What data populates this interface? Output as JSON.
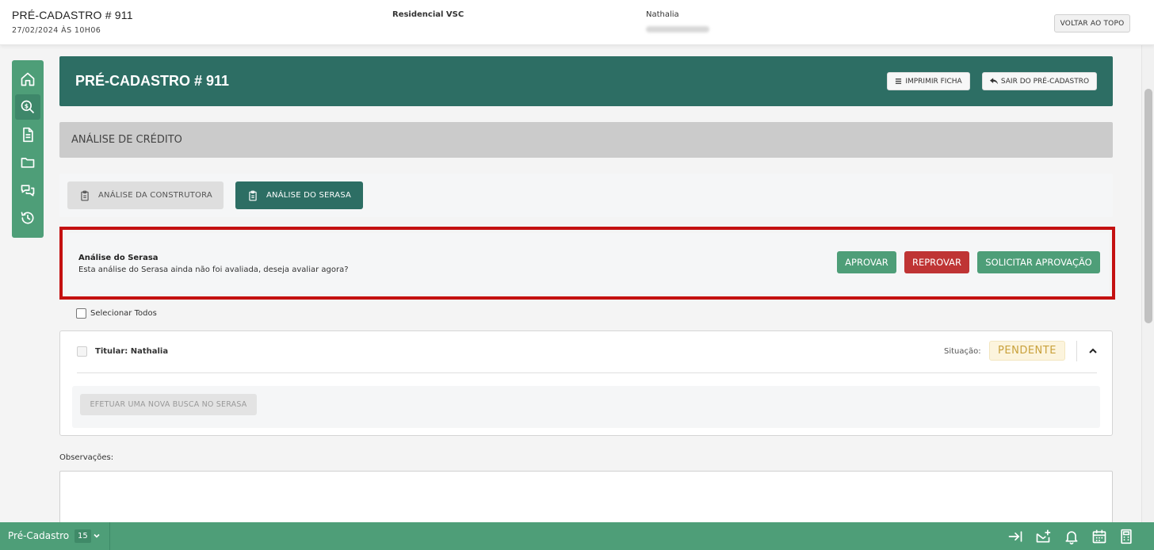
{
  "topbar": {
    "title": "PRÉ-CADASTRO # 911",
    "datetime": "27/02/2024 ÀS 10H06",
    "residencial": "Residencial VSC",
    "user_name": "Nathalia",
    "back_to_top_label": "VOLTAR AO TOPO"
  },
  "sidebar": {
    "items": [
      {
        "icon": "home-icon"
      },
      {
        "icon": "money-search-icon",
        "active": true
      },
      {
        "icon": "document-icon"
      },
      {
        "icon": "folder-icon"
      },
      {
        "icon": "chat-icon"
      },
      {
        "icon": "history-icon"
      }
    ]
  },
  "page_header": {
    "title": "PRÉ-CADASTRO # 911",
    "print_label": "IMPRIMIR FICHA",
    "exit_label": "SAIR DO PRÉ-CADASTRO"
  },
  "section": {
    "title": "ANÁLISE DE CRÉDITO"
  },
  "tabs": [
    {
      "label": "ANÁLISE DA CONSTRUTORA",
      "active": false
    },
    {
      "label": "ANÁLISE DO SERASA",
      "active": true
    }
  ],
  "alert": {
    "title": "Análise do Serasa",
    "message": "Esta análise do Serasa ainda não foi avaliada, deseja avaliar agora?",
    "approve_label": "APROVAR",
    "reject_label": "REPROVAR",
    "request_label": "SOLICITAR APROVAÇÃO"
  },
  "select_all_label": "Selecionar Todos",
  "card": {
    "titular": "Titular: Nathalia",
    "status_label": "Situação:",
    "status_value": "PENDENTE",
    "search_button_label": "EFETUAR UMA NOVA BUSCA NO SERASA"
  },
  "observations": {
    "label": "Observações:",
    "value": ""
  },
  "bottombar": {
    "label": "Pré-Cadastro",
    "count": "15",
    "icons": [
      "collapse-right-icon",
      "add-message-icon",
      "bell-icon",
      "calendar-icon",
      "calculator-icon"
    ]
  },
  "colors": {
    "primary_dark": "#2d6e64",
    "primary": "#4e9e78",
    "danger": "#bf3434",
    "highlight_outline": "#c41010",
    "pending_text": "#c9a13b"
  }
}
